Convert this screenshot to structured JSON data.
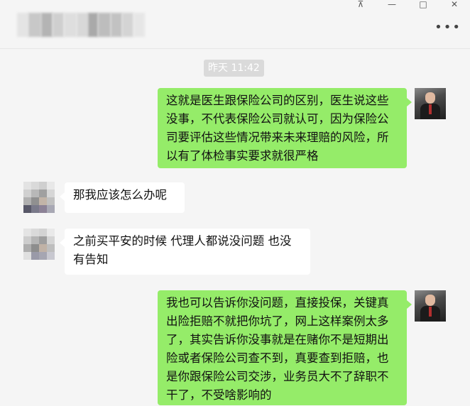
{
  "window": {
    "title_blurred": true,
    "controls": {
      "pin": "⊼",
      "minimize": "—",
      "maximize": "□",
      "close": "✕"
    },
    "more_label": "•••"
  },
  "chat": {
    "timestamp": "昨天 11:42",
    "messages": [
      {
        "sender": "self",
        "text": "这就是医生跟保险公司的区别，医生说这些没事，不代表保险公司就认可，因为保险公司要评估这些情况带来未来理赔的风险，所以有了体检事实要求就很严格"
      },
      {
        "sender": "other",
        "text": "那我应该怎么办呢"
      },
      {
        "sender": "other",
        "text": "之前买平安的时候 代理人都说没问题 也没有告知"
      },
      {
        "sender": "self",
        "text": "我也可以告诉你没问题，直接投保，关键真出险拒赔不就把你坑了，网上这样案例太多了，其实告诉你没事就是在赌你不是短期出险或者保险公司查不到，真要查到拒赔，也是你跟保险公司交涉，业务员大不了辞职不干了，不受啥影响的"
      }
    ]
  },
  "colors": {
    "background": "#f5f5f5",
    "self_bubble": "#95ec69",
    "other_bubble": "#ffffff",
    "timestamp_bg": "#dadada"
  },
  "icons": [
    "pin-icon",
    "minimize-icon",
    "maximize-icon",
    "close-icon",
    "more-icon",
    "avatar-self",
    "avatar-other"
  ]
}
